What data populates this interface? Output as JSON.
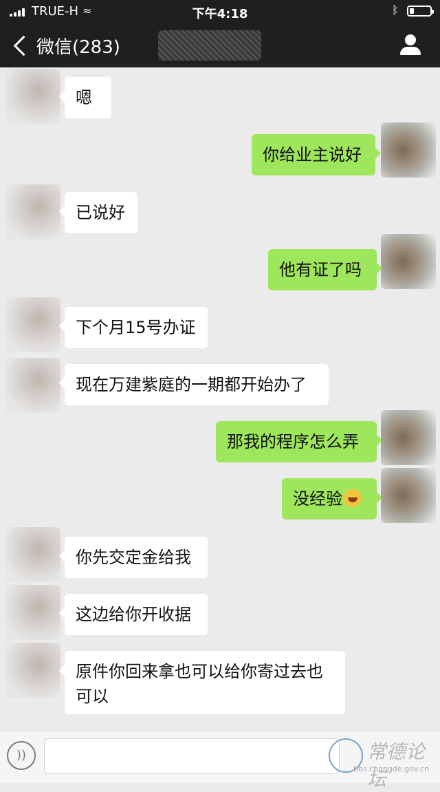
{
  "status_bar": {
    "carrier": "TRUE-H",
    "time": "下午4:18"
  },
  "nav": {
    "back_label": "微信(283)"
  },
  "messages": [
    {
      "side": "in",
      "text": "嗯"
    },
    {
      "side": "out",
      "text": "你给业主说好"
    },
    {
      "side": "in",
      "text": "已说好"
    },
    {
      "side": "out",
      "text": "他有证了吗"
    },
    {
      "side": "in",
      "text": "下个月15号办证"
    },
    {
      "side": "in",
      "text": "现在万建紫庭的一期都开始办了"
    },
    {
      "side": "out",
      "text": "那我的程序怎么弄"
    },
    {
      "side": "out",
      "text": "没经验",
      "emoji": "laughing-crying-emoji"
    },
    {
      "side": "in",
      "text": "你先交定金给我"
    },
    {
      "side": "in",
      "text": "这边给你开收据"
    },
    {
      "side": "in",
      "text": "原件你回来拿也可以给你寄过去也",
      "text_line2": "可以"
    }
  ],
  "watermark": {
    "text": "常德论坛",
    "url": "bbs.changde.gov.cn"
  },
  "colors": {
    "top_bar": "#1f1f1f",
    "background": "#ebebeb",
    "outgoing_bubble": "#9ee65c",
    "incoming_bubble": "#ffffff"
  }
}
